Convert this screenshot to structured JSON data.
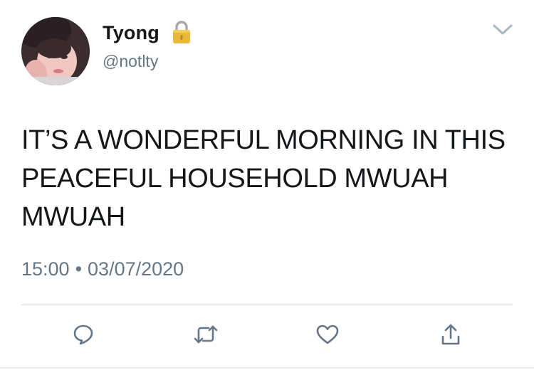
{
  "user": {
    "display_name": "Tyong",
    "handle": "@notlty",
    "avatar_icon": "profile-photo",
    "protected_icon": "lock-icon"
  },
  "tweet": {
    "text": "IT’S A WONDERFUL MORNING IN THIS PEACEFUL HOUSEHOLD MWUAH MWUAH",
    "time": "15:00",
    "separator": "•",
    "date": "03/07/2020"
  },
  "actions": [
    {
      "name": "reply",
      "icon": "reply-icon"
    },
    {
      "name": "retweet",
      "icon": "retweet-icon"
    },
    {
      "name": "like",
      "icon": "heart-icon"
    },
    {
      "name": "share",
      "icon": "share-icon"
    }
  ],
  "colors": {
    "text": "#14171a",
    "secondary": "#657786",
    "divider": "#d8dde1",
    "icon": "#657786",
    "lock": "#e8b93a"
  }
}
